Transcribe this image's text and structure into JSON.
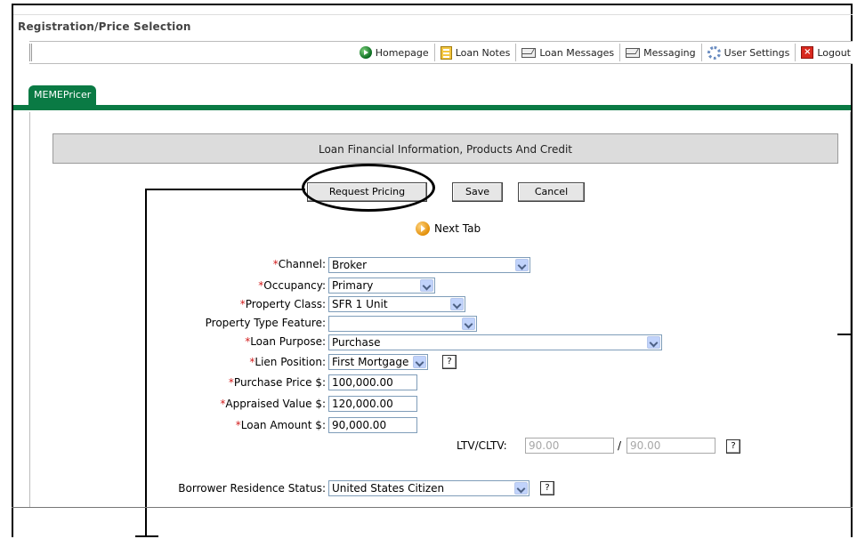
{
  "page": {
    "title": "Registration/Price Selection"
  },
  "toolbar": {
    "items": [
      {
        "label": "Homepage",
        "icon": "home-icon"
      },
      {
        "label": "Loan Notes",
        "icon": "notes-icon"
      },
      {
        "label": "Loan Messages",
        "icon": "envelope-icon"
      },
      {
        "label": "Messaging",
        "icon": "envelope-icon"
      },
      {
        "label": "User Settings",
        "icon": "gear-icon"
      },
      {
        "label": "Logout",
        "icon": "logout-icon"
      }
    ]
  },
  "tabs": [
    {
      "label": "MEMEPricer",
      "active": true
    }
  ],
  "section": {
    "title": "Loan Financial Information, Products And Credit"
  },
  "actions": {
    "request_pricing": "Request Pricing",
    "save": "Save",
    "cancel": "Cancel",
    "next_tab": "Next Tab"
  },
  "form": {
    "channel": {
      "label": "Channel:",
      "required": true,
      "value": "Broker"
    },
    "occupancy": {
      "label": "Occupancy:",
      "required": true,
      "value": "Primary"
    },
    "property_class": {
      "label": "Property Class:",
      "required": true,
      "value": "SFR 1 Unit"
    },
    "property_type_feature": {
      "label": "Property Type Feature:",
      "required": false,
      "value": ""
    },
    "loan_purpose": {
      "label": "Loan Purpose:",
      "required": true,
      "value": "Purchase"
    },
    "lien_position": {
      "label": "Lien Position:",
      "required": true,
      "value": "First Mortgage"
    },
    "purchase_price": {
      "label": "Purchase Price $:",
      "required": true,
      "value": "100,000.00"
    },
    "appraised_value": {
      "label": "Appraised Value $:",
      "required": true,
      "value": "120,000.00"
    },
    "loan_amount": {
      "label": "Loan Amount $:",
      "required": true,
      "value": "90,000.00"
    },
    "ltv_cltv": {
      "label": "LTV/CLTV:",
      "ltv": "90.00",
      "separator": "/",
      "cltv": "90.00"
    },
    "borrower_residence_status": {
      "label": "Borrower Residence Status:",
      "required": false,
      "value": "United States Citizen"
    }
  },
  "help_glyph": "?",
  "required_marker": "*",
  "colors": {
    "tab_green": "#0a7a44",
    "required_red": "#d21c1c",
    "section_gray": "#dcdcdc"
  }
}
